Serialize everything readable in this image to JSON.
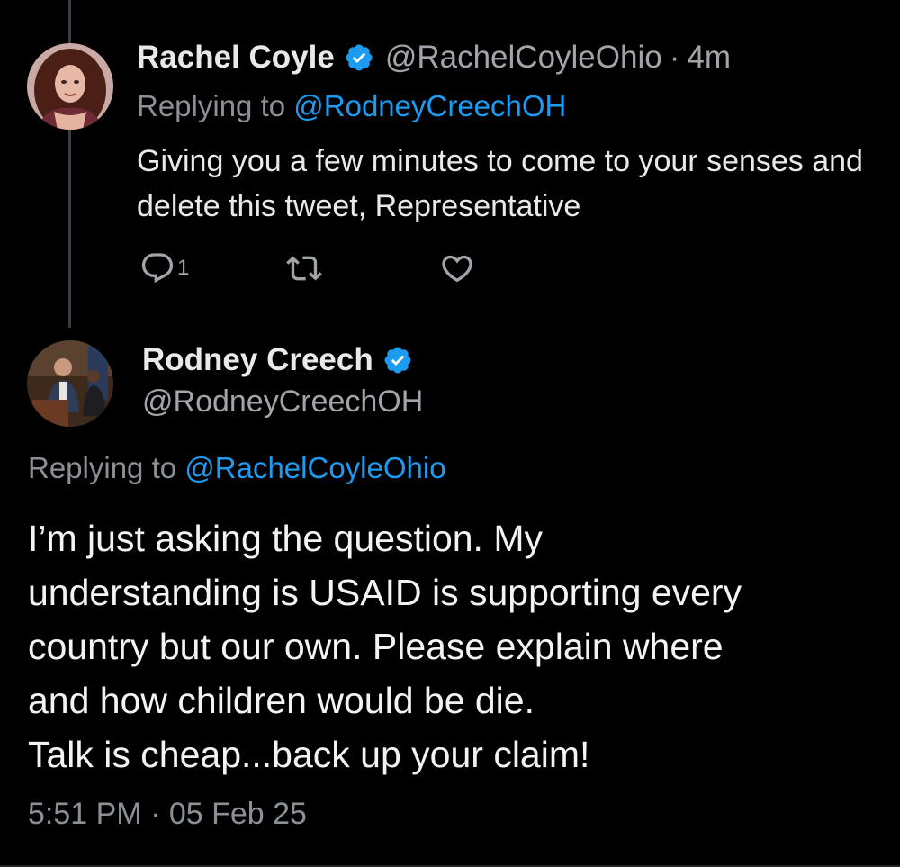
{
  "colors": {
    "background": "#000000",
    "text_primary": "#e7e9ea",
    "text_secondary": "#8b9096",
    "accent_link": "#1d9bf0",
    "verified_badge": "#1d9bf0",
    "thread_line": "#3a3d41"
  },
  "reply_tweet": {
    "author_name": "Rachel Coyle",
    "author_handle": "@RachelCoyleOhio",
    "separator": "·",
    "time_ago": "4m",
    "replying_to_prefix": "Replying to ",
    "replying_to_handle": "@RodneyCreechOH",
    "text": "Giving you a few minutes to come to your senses and delete this tweet, Representative",
    "actions": {
      "reply": {
        "icon": "reply-icon",
        "count": "1"
      },
      "retweet": {
        "icon": "retweet-icon"
      },
      "like": {
        "icon": "heart-icon"
      }
    },
    "avatar_icon": "avatar-rachel-coyle",
    "verified_icon": "verified-badge-icon"
  },
  "main_tweet": {
    "author_name": "Rodney Creech",
    "author_handle": "@RodneyCreechOH",
    "replying_to_prefix": "Replying to ",
    "replying_to_handle": "@RachelCoyleOhio",
    "text_lines": [
      "I’m just asking the question. My",
      "understanding is USAID is supporting every",
      "country but our own. Please explain where",
      "and how children would be die.",
      "Talk is cheap...back up your claim!"
    ],
    "timestamp": "5:51 PM · 05 Feb 25",
    "avatar_icon": "avatar-rodney-creech",
    "verified_icon": "verified-badge-icon"
  }
}
